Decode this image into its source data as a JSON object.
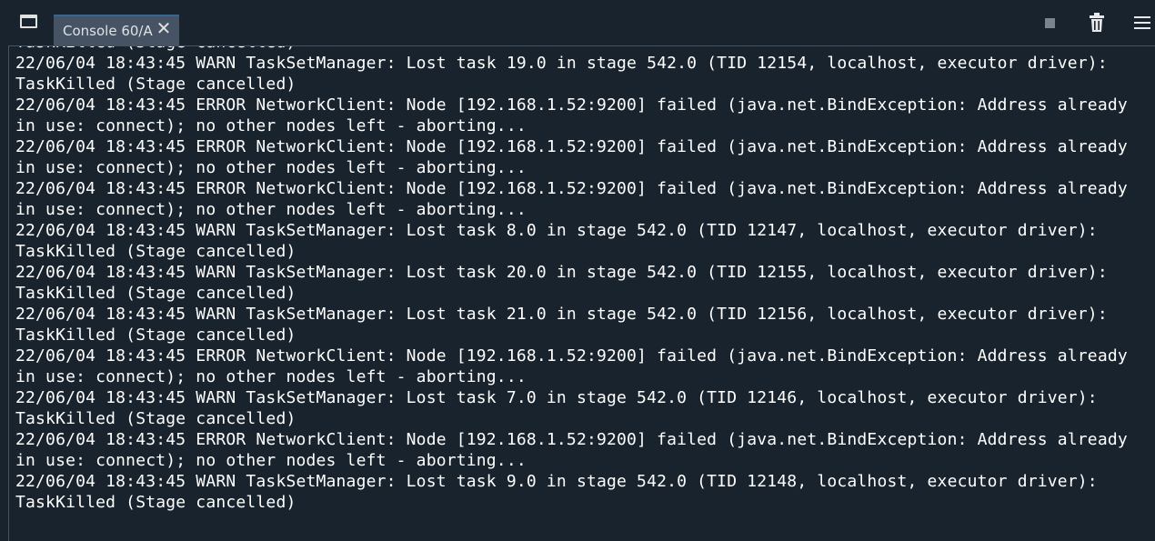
{
  "tab": {
    "title": "Console 60/A"
  },
  "icons": {
    "window": "window-icon",
    "close": "close-icon",
    "stop": "stop-icon",
    "trash": "trash-icon",
    "menu": "hamburger-menu-icon"
  },
  "colors": {
    "background": "#19232d",
    "tab_background": "#455364",
    "text": "#ffffff",
    "stop_icon": "#7a8390"
  },
  "console": {
    "lines": [
      "TaskKilled (Stage cancelled)",
      "22/06/04 18:43:45 WARN TaskSetManager: Lost task 19.0 in stage 542.0 (TID 12154, localhost, executor driver):",
      "TaskKilled (Stage cancelled)",
      "22/06/04 18:43:45 ERROR NetworkClient: Node [192.168.1.52:9200] failed (java.net.BindException: Address already",
      "in use: connect); no other nodes left - aborting...",
      "22/06/04 18:43:45 ERROR NetworkClient: Node [192.168.1.52:9200] failed (java.net.BindException: Address already",
      "in use: connect); no other nodes left - aborting...",
      "22/06/04 18:43:45 ERROR NetworkClient: Node [192.168.1.52:9200] failed (java.net.BindException: Address already",
      "in use: connect); no other nodes left - aborting...",
      "22/06/04 18:43:45 WARN TaskSetManager: Lost task 8.0 in stage 542.0 (TID 12147, localhost, executor driver):",
      "TaskKilled (Stage cancelled)",
      "22/06/04 18:43:45 WARN TaskSetManager: Lost task 20.0 in stage 542.0 (TID 12155, localhost, executor driver):",
      "TaskKilled (Stage cancelled)",
      "22/06/04 18:43:45 WARN TaskSetManager: Lost task 21.0 in stage 542.0 (TID 12156, localhost, executor driver):",
      "TaskKilled (Stage cancelled)",
      "22/06/04 18:43:45 ERROR NetworkClient: Node [192.168.1.52:9200] failed (java.net.BindException: Address already",
      "in use: connect); no other nodes left - aborting...",
      "22/06/04 18:43:45 WARN TaskSetManager: Lost task 7.0 in stage 542.0 (TID 12146, localhost, executor driver):",
      "TaskKilled (Stage cancelled)",
      "22/06/04 18:43:45 ERROR NetworkClient: Node [192.168.1.52:9200] failed (java.net.BindException: Address already",
      "in use: connect); no other nodes left - aborting...",
      "22/06/04 18:43:45 WARN TaskSetManager: Lost task 9.0 in stage 542.0 (TID 12148, localhost, executor driver):",
      "TaskKilled (Stage cancelled)"
    ]
  }
}
